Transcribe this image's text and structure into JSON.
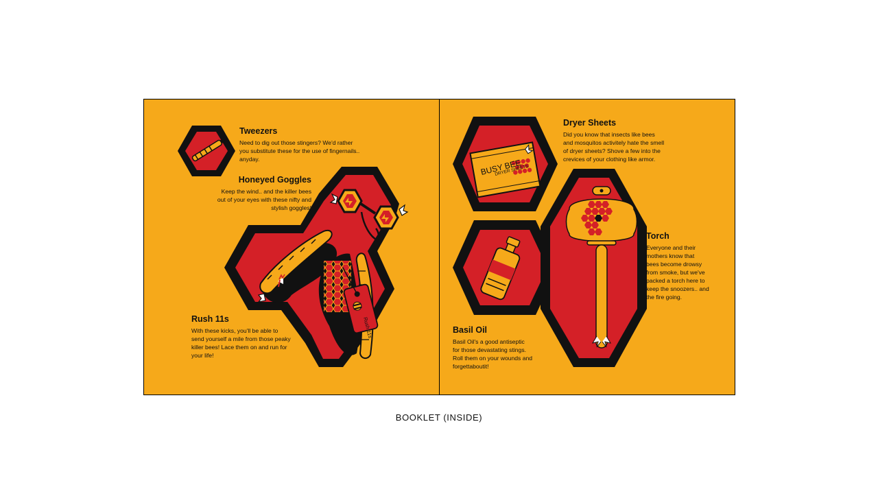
{
  "colors": {
    "background": "#f6a91a",
    "red": "#d42027",
    "black": "#111111",
    "yellow": "#f6a91a",
    "white": "#ffffff"
  },
  "items": {
    "tweezers": {
      "title": "Tweezers",
      "lines": [
        "Need to dig out those stingers? We'd rather",
        "you substitute these for the use of fingernails..",
        "anyday."
      ]
    },
    "goggles": {
      "title": "Honeyed Goggles",
      "lines": [
        "Keep the wind.. and the killer bees",
        "out of your eyes with these nifty and",
        "stylish goggles!"
      ]
    },
    "rush": {
      "title": "Rush 11s",
      "lines": [
        "With these kicks, you'll be able to",
        "send yourself a mile from those peaky",
        "killer bees! Lace them on and run for",
        "your life!"
      ]
    },
    "dryer": {
      "title": "Dryer Sheets",
      "lines": [
        "Did you know that insects like bees",
        "and mosquitos activitely hate the smell",
        "of dryer sheets? Shove a few into the",
        "crevices of your clothing like armor."
      ]
    },
    "torch": {
      "title": "Torch",
      "lines": [
        "Everyone and their",
        "mothers know that",
        "bees become drowsy",
        "from smoke, but we've",
        "packed a torch here to",
        "keep the snoozers.. and",
        "the fire going."
      ]
    },
    "basil": {
      "title": "Basil Oil",
      "lines": [
        "Basil Oil's a good antiseptic",
        "for those devastating stings.",
        "Roll them on your wounds and",
        "forgettaboutit!"
      ]
    }
  },
  "product_labels": {
    "dryer_box_brand": "BUSY BEE",
    "dryer_box_sub": "DRYER SHEETS",
    "shoe_tag": "Rush 11s"
  },
  "caption": "BOOKLET (INSIDE)"
}
